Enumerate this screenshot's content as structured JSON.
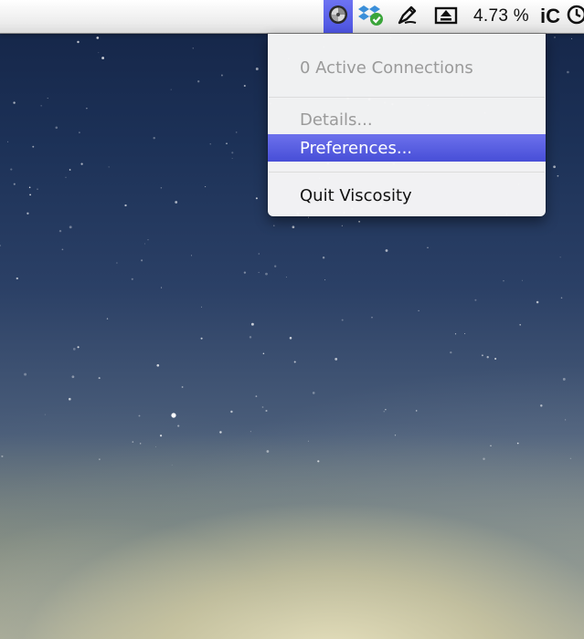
{
  "menubar": {
    "status_icons": [
      {
        "name": "viscosity-icon",
        "active": true
      },
      {
        "name": "dropbox-sync-icon"
      },
      {
        "name": "pen-tool-icon"
      },
      {
        "name": "eject-icon"
      }
    ],
    "battery_text": "4.73 %",
    "app_text": "iC"
  },
  "menu": {
    "items": [
      {
        "label": "0 Active Connections",
        "state": "disabled"
      },
      {
        "label": "Details...",
        "state": "disabled"
      },
      {
        "label": "Preferences...",
        "state": "highlighted"
      },
      {
        "label": "Quit Viscosity",
        "state": "enabled"
      }
    ]
  },
  "colors": {
    "menu_highlight": "#5a60e6",
    "disabled_text": "#9a9a9a"
  }
}
